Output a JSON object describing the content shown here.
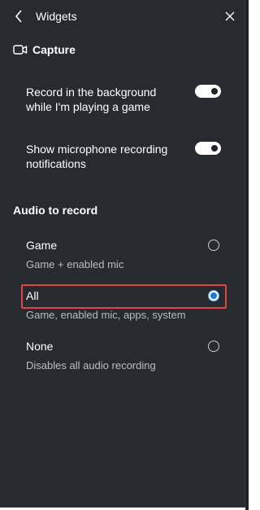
{
  "header": {
    "title": "Widgets",
    "back_icon": "chevron-left-icon",
    "close_icon": "close-icon"
  },
  "capture": {
    "title": "Capture",
    "icon": "video-camera-icon",
    "settings": [
      {
        "label_line1": "Record in the background",
        "label_line2": "while I'm playing a game",
        "enabled": true
      },
      {
        "label_line1": "Show microphone recording",
        "label_line2": "notifications",
        "enabled": true
      }
    ]
  },
  "audio": {
    "title": "Audio to record",
    "options": [
      {
        "label": "Game",
        "description": "Game + enabled mic",
        "selected": false
      },
      {
        "label": "All",
        "description": "Game, enabled mic, apps, system",
        "selected": true
      },
      {
        "label": "None",
        "description": "Disables all audio recording",
        "selected": false
      }
    ]
  },
  "colors": {
    "panel_bg": "#272a2f",
    "accent": "#1a78e0",
    "highlight": "#e04646"
  }
}
